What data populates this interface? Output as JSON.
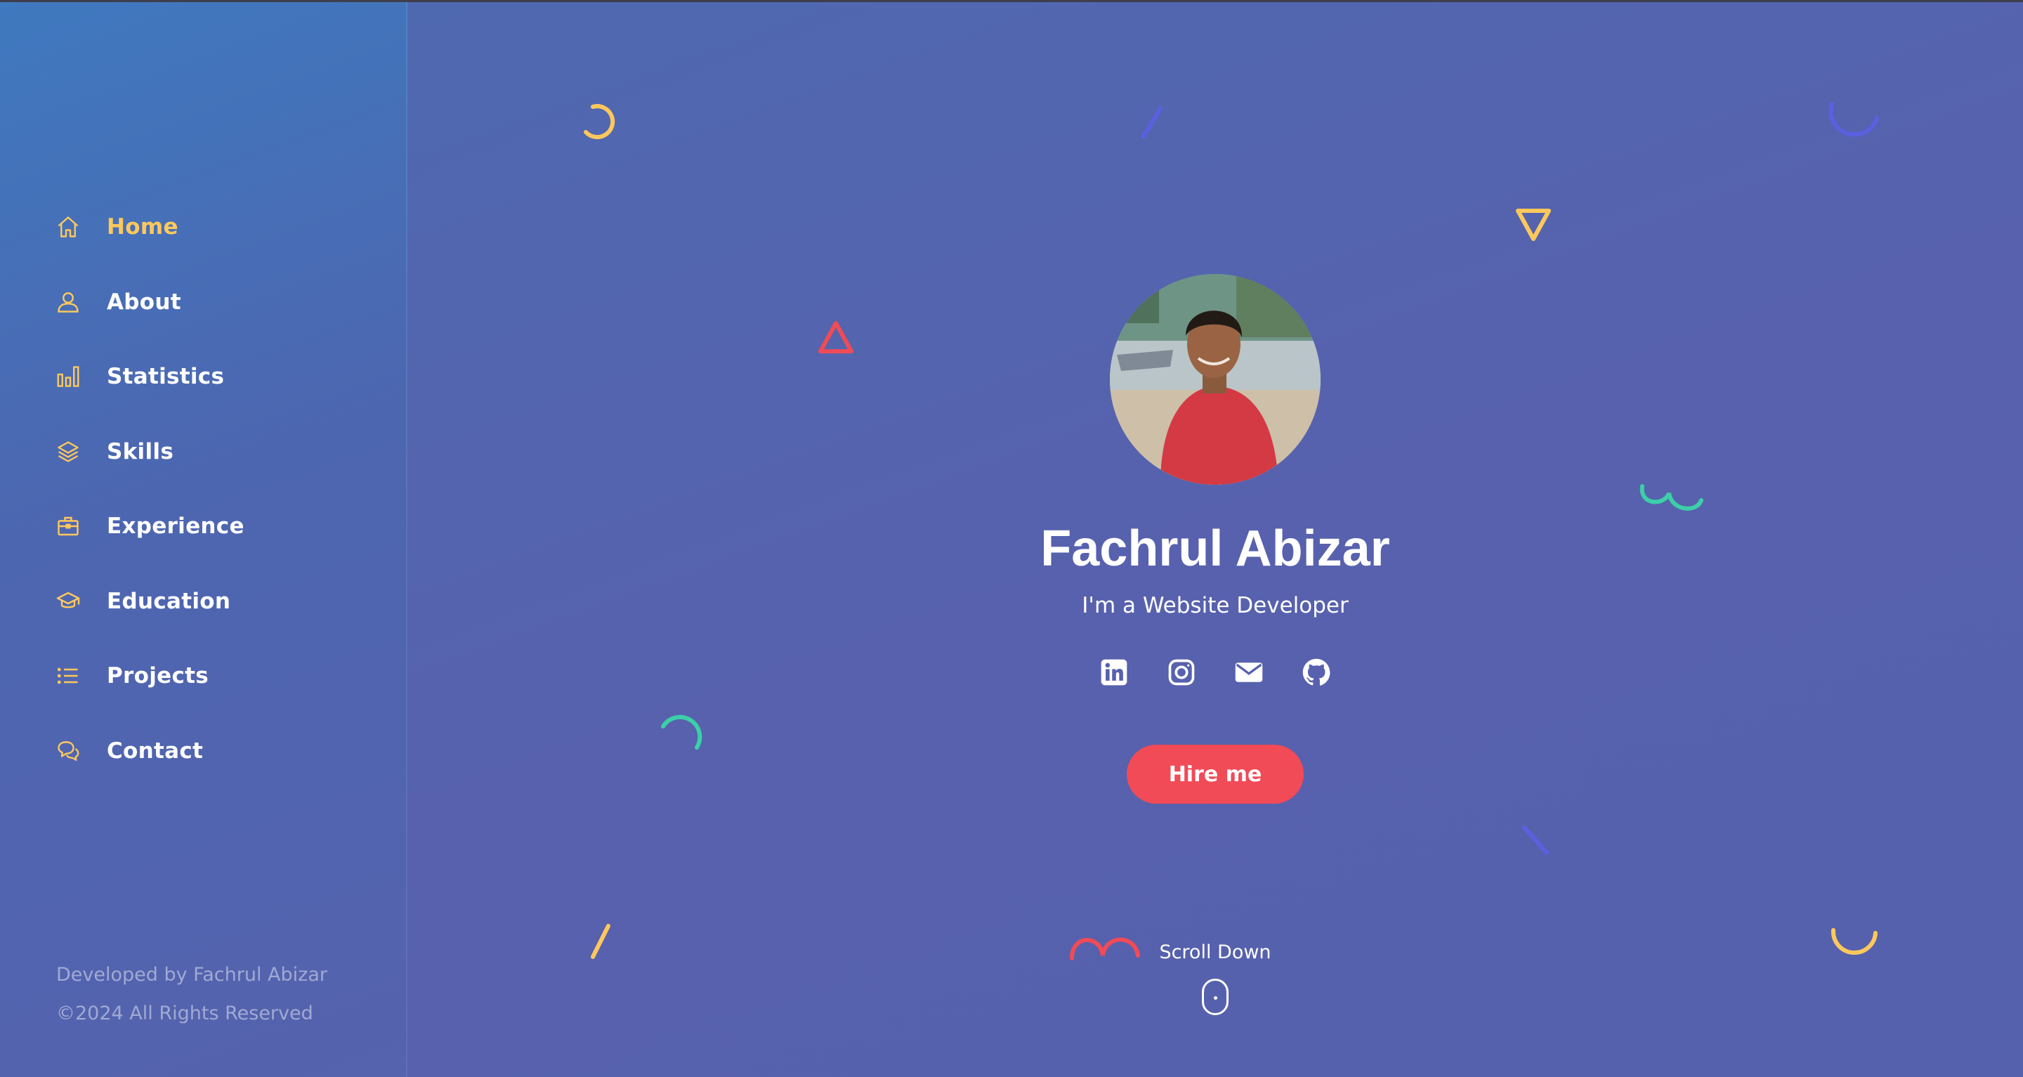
{
  "sidebar": {
    "items": [
      {
        "label": "Home",
        "icon": "home-icon",
        "active": true
      },
      {
        "label": "About",
        "icon": "user-icon",
        "active": false
      },
      {
        "label": "Statistics",
        "icon": "bar-chart-icon",
        "active": false
      },
      {
        "label": "Skills",
        "icon": "layers-icon",
        "active": false
      },
      {
        "label": "Experience",
        "icon": "briefcase-icon",
        "active": false
      },
      {
        "label": "Education",
        "icon": "graduation-cap-icon",
        "active": false
      },
      {
        "label": "Projects",
        "icon": "list-icon",
        "active": false
      },
      {
        "label": "Contact",
        "icon": "chat-icon",
        "active": false
      }
    ],
    "footer": {
      "developed_by": "Developed by Fachrul Abizar",
      "copyright": "©2024 All Rights Reserved"
    }
  },
  "hero": {
    "name": "Fachrul Abizar",
    "role": "I'm a Website Developer",
    "socials": [
      {
        "icon": "linkedin-icon"
      },
      {
        "icon": "instagram-icon"
      },
      {
        "icon": "mail-icon"
      },
      {
        "icon": "github-icon"
      }
    ],
    "hire_label": "Hire me",
    "scroll_label": "Scroll Down"
  },
  "colors": {
    "accent_yellow": "#ffc85c",
    "accent_red": "#f04b57",
    "accent_teal": "#3ccfa8",
    "accent_purple": "#5b5fe0",
    "sidebar_bg": "#4d66b0",
    "main_bg": "#5661ad"
  }
}
